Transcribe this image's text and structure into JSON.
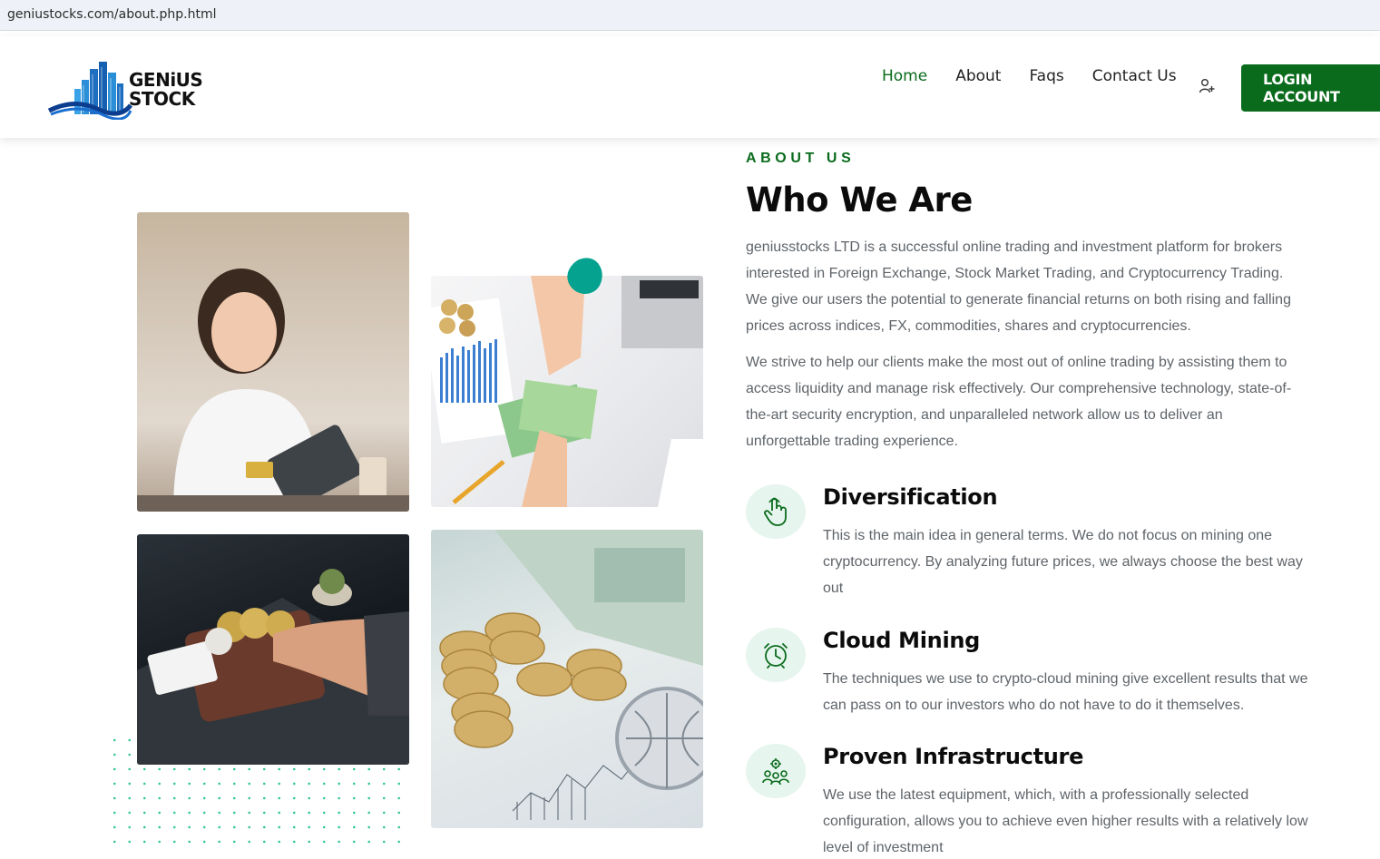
{
  "browser": {
    "url": "geniustocks.com/about.php.html"
  },
  "header": {
    "logo_text_line1": "GENiUS",
    "logo_text_line2": "STOCK",
    "nav": [
      {
        "label": "Home",
        "active": true
      },
      {
        "label": "About"
      },
      {
        "label": "Faqs"
      },
      {
        "label": "Contact Us"
      }
    ],
    "user_icon": "user-plus-icon",
    "login_label": "LOGIN ACCOUNT",
    "accent_color": "#0a6b1c"
  },
  "about": {
    "eyebrow": "ABOUT US",
    "title": "Who We Are",
    "paragraph1": "geniusstocks LTD is a successful online trading and investment platform for brokers interested in Foreign Exchange, Stock Market Trading, and Cryptocurrency Trading. We give our users the potential to generate financial returns on both rising and falling prices across indices, FX, commodities, shares and cryptocurrencies.",
    "paragraph2": "We strive to help our clients make the most out of online trading by assisting them to access liquidity and manage risk effectively. Our comprehensive technology, state-of-the-art security encryption, and unparalleled network allow us to deliver an unforgettable trading experience.",
    "features": [
      {
        "icon": "hand-pointer-icon",
        "title": "Diversification",
        "text": "This is the main idea in general terms. We do not focus on mining one cryptocurrency. By analyzing future prices, we always choose the best way out"
      },
      {
        "icon": "alarm-clock-icon",
        "title": "Cloud Mining",
        "text": "The techniques we use to crypto-cloud mining give excellent results that we can pass on to our investors who do not have to do it themselves."
      },
      {
        "icon": "team-gear-icon",
        "title": "Proven Infrastructure",
        "text": "We use the latest equipment, which, with a professionally selected configuration, allows you to achieve even higher results with a relatively low level of investment"
      }
    ]
  }
}
